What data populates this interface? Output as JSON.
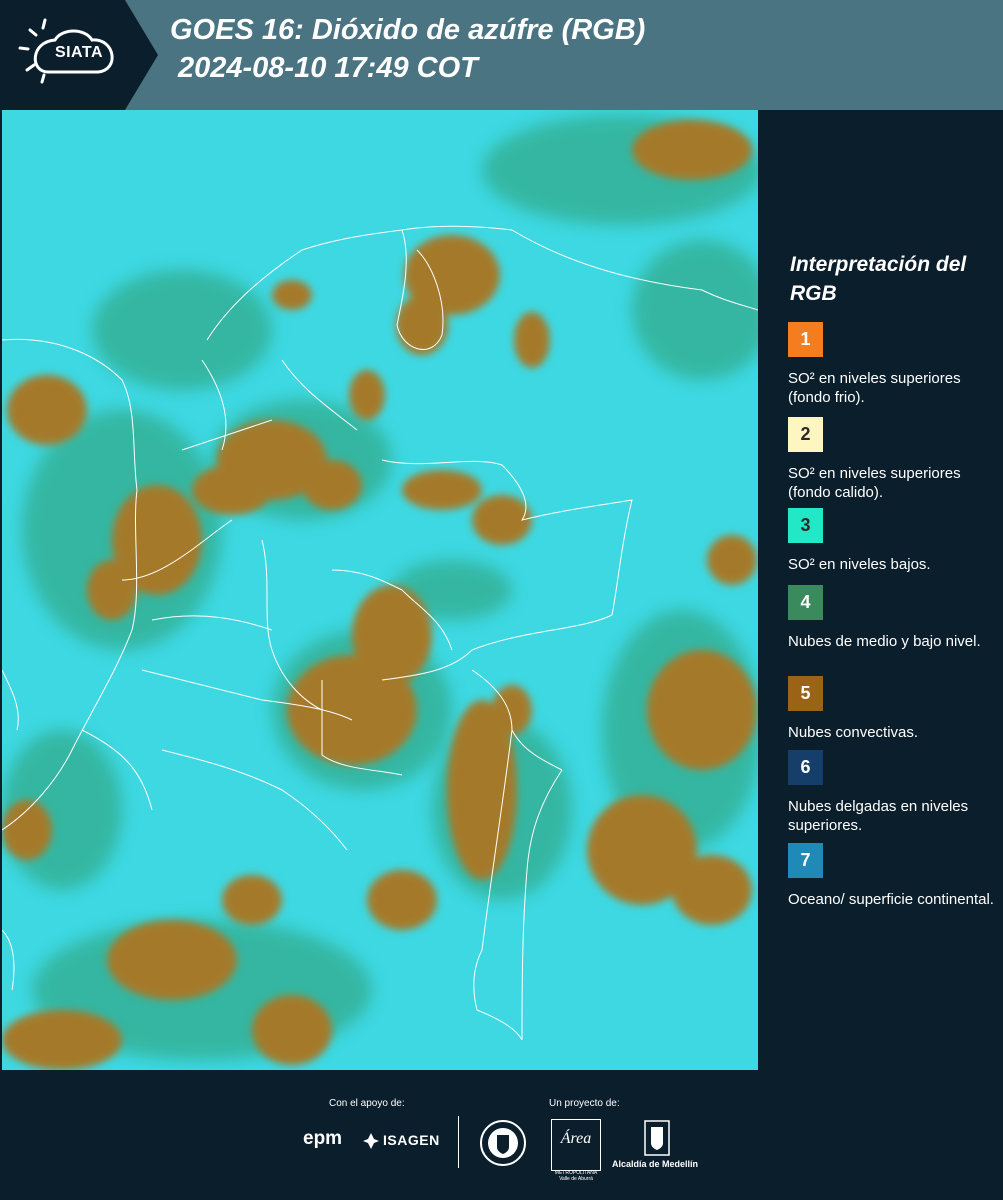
{
  "header": {
    "logo_text": "SIATA",
    "title_line1": "GOES 16: Dióxido de azúfre (RGB)",
    "title_line2": "2024-08-10 17:49 COT"
  },
  "legend": {
    "title": "Interpretación del RGB",
    "items": [
      {
        "number": "1",
        "color": "#f47d20",
        "label": "SO² en niveles superiores (fondo frio)."
      },
      {
        "number": "2",
        "color": "#fdf6c1",
        "label": "SO² en niveles superiores (fondo calido)."
      },
      {
        "number": "3",
        "color": "#22e8c8",
        "label": "SO² en niveles bajos."
      },
      {
        "number": "4",
        "color": "#3a8a5e",
        "label": "Nubes de medio y bajo nivel."
      },
      {
        "number": "5",
        "color": "#9a6315",
        "label": "Nubes convectivas."
      },
      {
        "number": "6",
        "color": "#163e6b",
        "label": "Nubes delgadas en niveles superiores."
      },
      {
        "number": "7",
        "color": "#1f8ab8",
        "label": "Oceano/ superficie continental."
      }
    ]
  },
  "footer": {
    "support_caption": "Con el apoyo de:",
    "project_caption": "Un proyecto de:",
    "epm": "epm",
    "isagen": "ISAGEN",
    "area": "Área",
    "area_sub": "METROPOLITANA Valle de Aburrá",
    "alcaldia": "Alcaldía de Medellín"
  },
  "map": {
    "background_color": "#3dd8e2",
    "cloud_color": "#a47a2a",
    "low_cloud_color": "#2e9c6e",
    "border_color": "#ffffff"
  }
}
